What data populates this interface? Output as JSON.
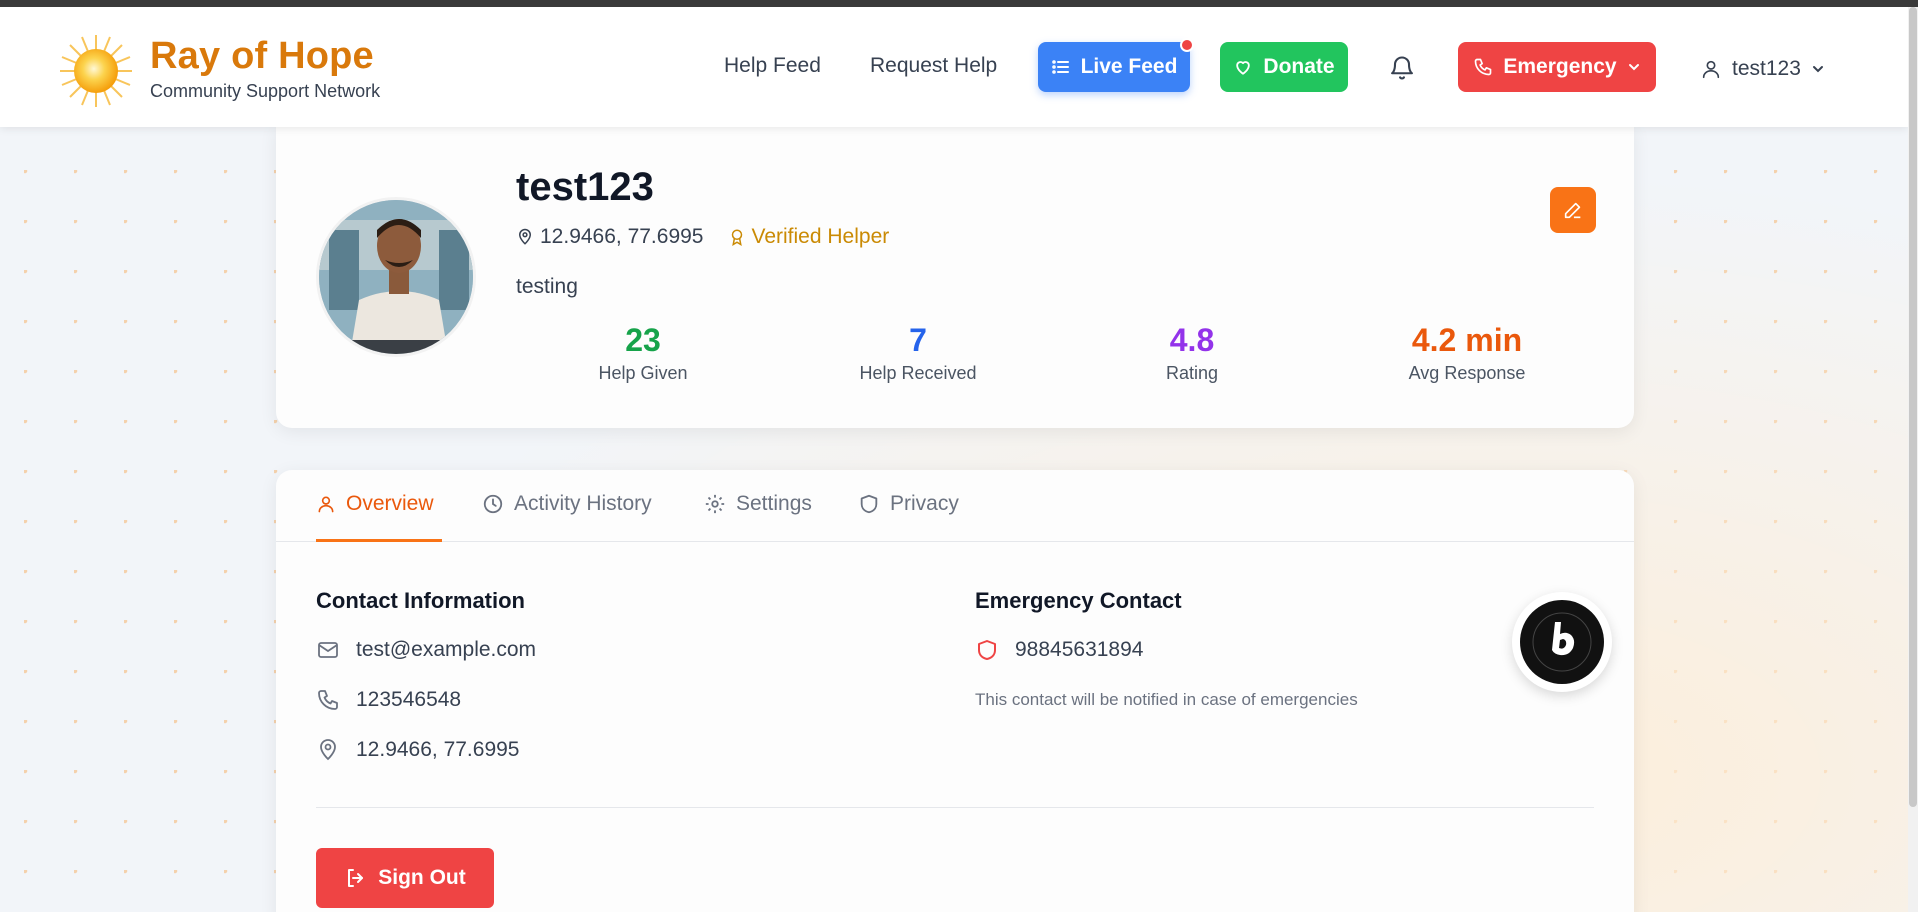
{
  "brand": {
    "title": "Ray of Hope",
    "subtitle": "Community Support Network"
  },
  "nav": {
    "help_feed": "Help Feed",
    "request_help": "Request Help",
    "live_feed": "Live Feed",
    "donate": "Donate",
    "emergency": "Emergency",
    "username": "test123"
  },
  "profile": {
    "username": "test123",
    "location": "12.9466, 77.6995",
    "verified": "Verified Helper",
    "bio": "testing",
    "stats": [
      {
        "value": "23",
        "label": "Help Given",
        "color": "#16a34a"
      },
      {
        "value": "7",
        "label": "Help Received",
        "color": "#2563eb"
      },
      {
        "value": "4.8",
        "label": "Rating",
        "color": "#9333ea"
      },
      {
        "value": "4.2 min",
        "label": "Avg Response",
        "color": "#ea580c"
      }
    ]
  },
  "tabs": [
    {
      "label": "Overview",
      "icon": "user-icon",
      "active": true
    },
    {
      "label": "Activity History",
      "icon": "clock-icon",
      "active": false
    },
    {
      "label": "Settings",
      "icon": "gear-icon",
      "active": false
    },
    {
      "label": "Privacy",
      "icon": "shield-icon",
      "active": false
    }
  ],
  "contact": {
    "title": "Contact Information",
    "email": "test@example.com",
    "phone": "123546548",
    "location": "12.9466, 77.6995"
  },
  "emergency_contact": {
    "title": "Emergency Contact",
    "phone": "98845631894",
    "note": "This contact will be notified in case of emergencies"
  },
  "sign_out": "Sign Out",
  "colors": {
    "brand": "#d9790b",
    "accent": "#f97316",
    "live": "#3b82f6",
    "donate": "#22c55e",
    "emergency": "#ef4444"
  }
}
